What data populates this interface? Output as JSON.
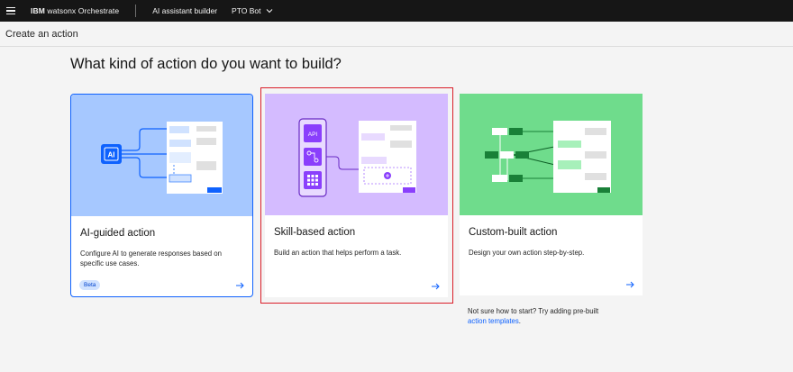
{
  "topbar": {
    "brand_bold": "IBM",
    "brand_rest": "watsonx Orchestrate",
    "nav_link": "AI assistant builder",
    "assistant_select": "PTO Bot"
  },
  "subheader": {
    "title": "Create an action"
  },
  "headline": "What kind of action do you want to build?",
  "cards": [
    {
      "title": "AI-guided action",
      "description": "Configure AI to generate responses based on specific use cases.",
      "badge": "Beta",
      "art_label": "AI",
      "accent": "#0f62fe",
      "selected": false
    },
    {
      "title": "Skill-based action",
      "description": "Build an action that helps perform a task.",
      "art_label": "API",
      "accent": "#8a3ffc",
      "selected": true
    },
    {
      "title": "Custom-built action",
      "description": "Design your own action step-by-step.",
      "accent": "#198038",
      "selected": false
    }
  ],
  "hint": {
    "text": "Not sure how to start? Try adding pre-built",
    "link": "action templates",
    "suffix": "."
  },
  "colors": {
    "topbar_bg": "#161616",
    "selected_outline": "#da1e28",
    "link": "#0f62fe"
  }
}
